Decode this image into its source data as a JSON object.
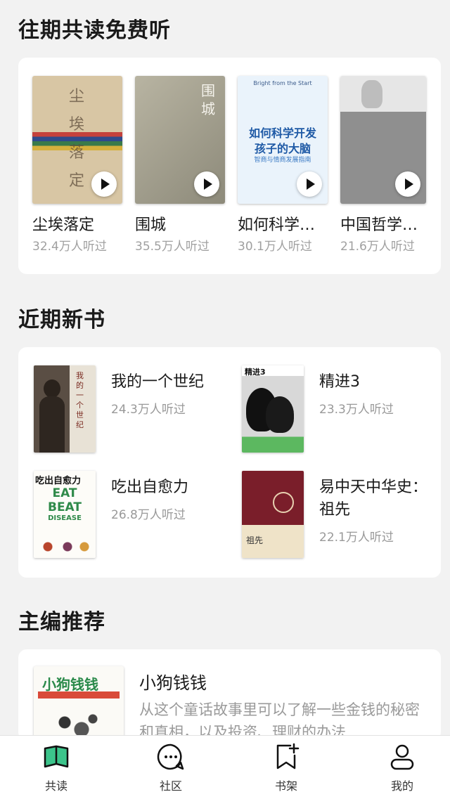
{
  "sections": {
    "free_listen": {
      "title": "往期共读免费听",
      "items": [
        {
          "name": "尘埃落定",
          "count": "32.4万人听过"
        },
        {
          "name": "围城",
          "count": "35.5万人听过"
        },
        {
          "name": "如何科学…",
          "count": "30.1万人听过"
        },
        {
          "name": "中国哲学…",
          "count": "21.6万人听过"
        }
      ]
    },
    "new_books": {
      "title": "近期新书",
      "items": [
        {
          "title": "我的一个世纪",
          "count": "24.3万人听过"
        },
        {
          "title": "精进3",
          "count": "23.3万人听过"
        },
        {
          "title": "吃出自愈力",
          "count": "26.8万人听过"
        },
        {
          "title": "易中天中华史：祖先",
          "count": "22.1万人听过"
        }
      ]
    },
    "editor_rec": {
      "title": "主编推荐",
      "book_title": "小狗钱钱",
      "desc": "从这个童话故事里可以了解一些金钱的秘密和真相，以及投资、理财的办法"
    }
  },
  "covers": {
    "c1_title": "尘埃落定",
    "c2_title": "围城",
    "c3_top": "Bright from the Start",
    "c3_title_1": "如何科学开发",
    "c3_title_2": "孩子的大脑",
    "c3_sub": "智商与情商发展指南",
    "n1_title": "我的一个世纪",
    "n2_title": "精进3",
    "n3_title": "吃出自愈力",
    "n3_en1": "EAT",
    "n3_en2": "BEAT",
    "n3_en3": "DISEASE",
    "n4_sub": "祖先",
    "r_title": "小狗钱钱"
  },
  "bottom_nav": [
    {
      "label": "共读",
      "icon": "book-open-icon",
      "active": true
    },
    {
      "label": "社区",
      "icon": "chat-bubble-icon",
      "active": false
    },
    {
      "label": "书架",
      "icon": "bookshelf-add-icon",
      "active": false
    },
    {
      "label": "我的",
      "icon": "person-icon",
      "active": false
    }
  ],
  "colors": {
    "accent": "#3cc48b",
    "background": "#f2f2f2",
    "card": "#ffffff",
    "muted_text": "#999999"
  }
}
